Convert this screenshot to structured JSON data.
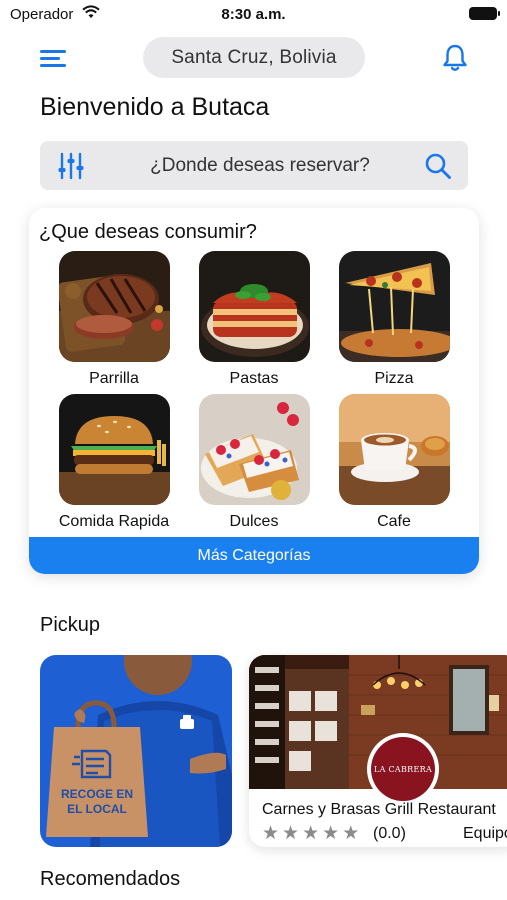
{
  "status_bar": {
    "carrier": "Operador",
    "time": "8:30 a.m."
  },
  "header": {
    "location": "Santa Cruz, Bolivia"
  },
  "welcome": "Bienvenido a Butaca",
  "search": {
    "placeholder": "¿Donde deseas reservar?"
  },
  "categories": {
    "title": "¿Que deseas consumir?",
    "items": [
      {
        "label": "Parrilla",
        "icon": "grilled-steak-photo"
      },
      {
        "label": "Pastas",
        "icon": "lasagna-photo"
      },
      {
        "label": "Pizza",
        "icon": "pizza-photo"
      },
      {
        "label": "Comida Rapida",
        "icon": "burger-photo"
      },
      {
        "label": "Dulces",
        "icon": "desserts-photo"
      },
      {
        "label": "Cafe",
        "icon": "coffee-photo"
      }
    ],
    "more_label": "Más Categorías"
  },
  "pickup": {
    "title": "Pickup",
    "banner_text": "RECOGE EN\nEL LOCAL",
    "restaurant": {
      "name": "Carnes y Brasas Grill Restaurant",
      "logo_text": "LA CABRERA",
      "rating_value": 0.0,
      "rating": "(0.0)",
      "tag": "Equipo"
    }
  },
  "recommended": {
    "title": "Recomendados"
  },
  "colors": {
    "accent": "#1a80f0",
    "icon_blue": "#1977e8",
    "pill_bg": "#e9e9ec",
    "star_gray": "#8b8b8b"
  }
}
